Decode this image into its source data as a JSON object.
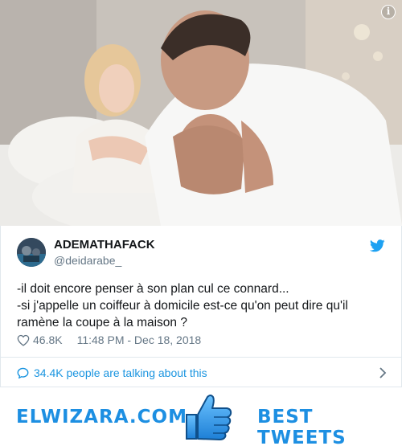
{
  "tweet": {
    "author_name": "ADEMATHAFACK",
    "author_handle": "@deidarabe_",
    "text_lines": [
      "-il doit encore penser à son plan cul ce connard...",
      "-si j'appelle un coiffeur à domicile est-ce qu'on peut dire qu'il",
      "ramène la coupe à la maison ?"
    ],
    "likes": "46.8K",
    "timestamp": "11:48 PM - Dec 18, 2018",
    "talking": "34.4K people are talking about this"
  },
  "photo": {
    "info_label": "i"
  },
  "banner": {
    "left": "ELWIZARA.COM",
    "right": "BEST TWEETS"
  },
  "colors": {
    "twitter_blue": "#1da1f2",
    "link_blue": "#1b95e0",
    "meta_gray": "#657786",
    "banner_blue": "#1d8fe2"
  },
  "icons": {
    "info": "info-icon",
    "twitter": "twitter-bird-icon",
    "like": "heart-icon",
    "reply": "speech-bubble-icon",
    "chevron": "chevron-right-icon",
    "thumb": "thumbs-up-icon"
  }
}
